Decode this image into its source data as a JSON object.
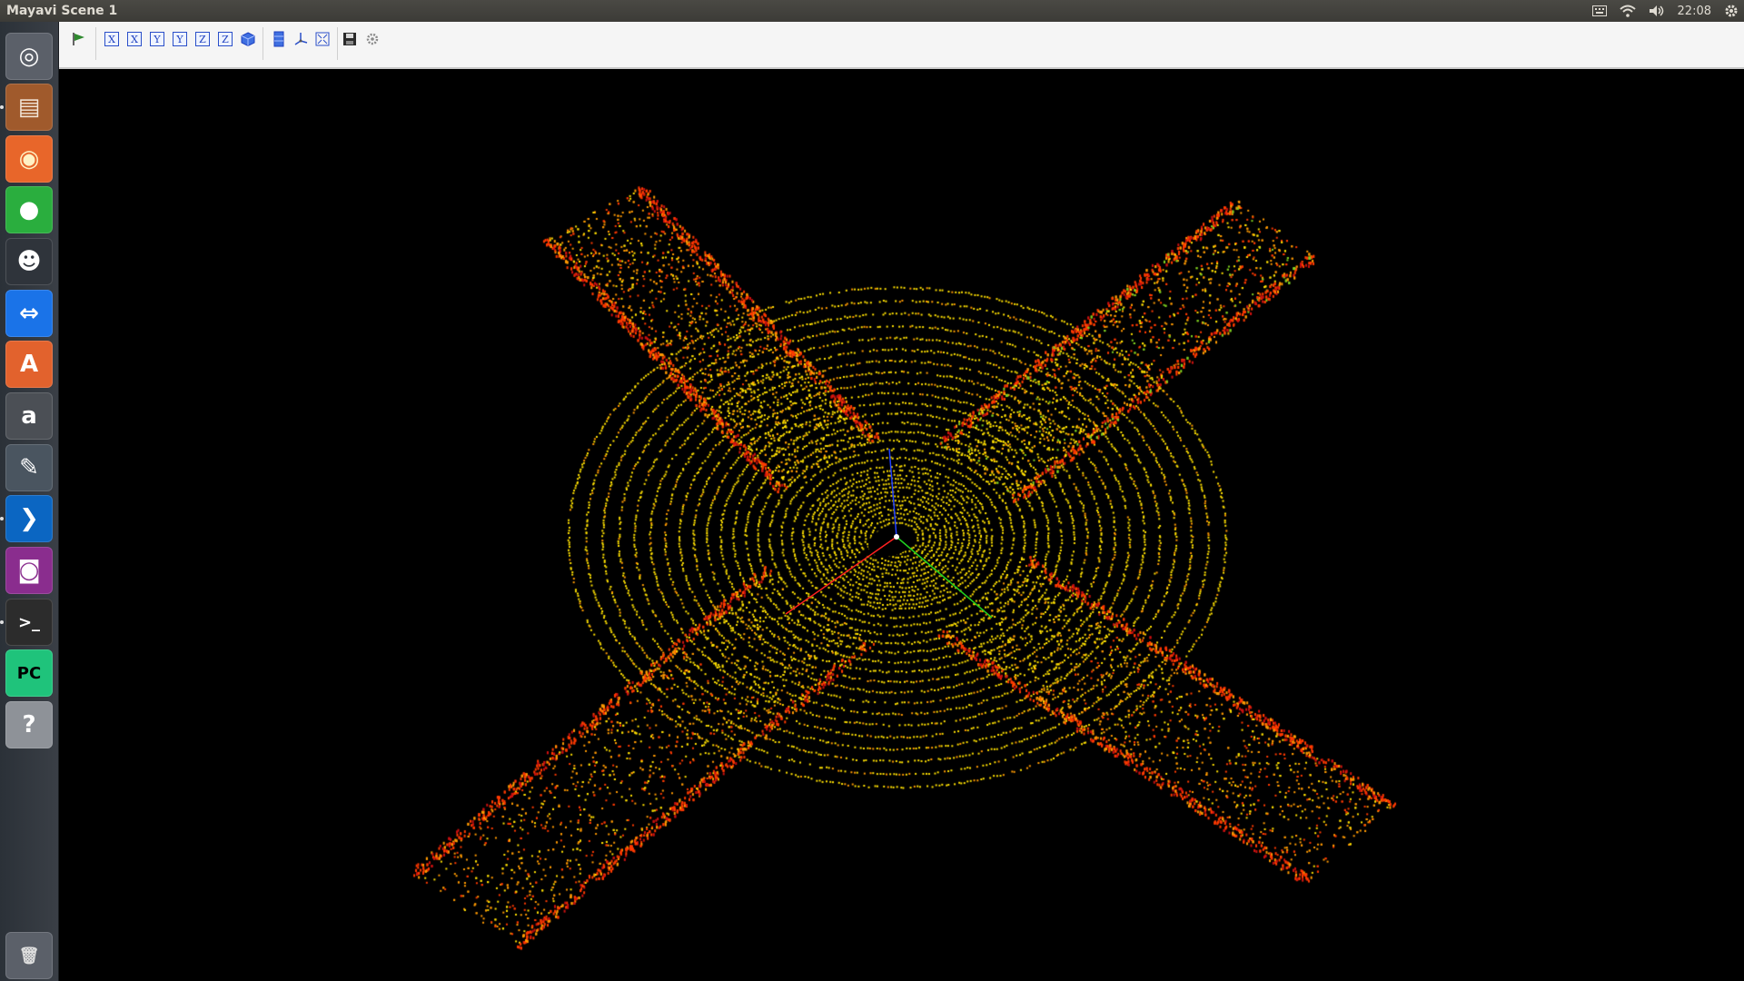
{
  "window": {
    "title": "Mayavi Scene 1"
  },
  "panel": {
    "clock": "22:08",
    "indicators": [
      "keyboard-icon",
      "wifi-icon",
      "volume-icon",
      "settings-gear-icon"
    ]
  },
  "launcher": {
    "items": [
      {
        "name": "dash-home-icon",
        "bg": "#5b6069",
        "glyph": "◎",
        "color": "#ffffff"
      },
      {
        "name": "files-icon",
        "bg": "#a05a2c",
        "glyph": "▤",
        "color": "#f2e6d9"
      },
      {
        "name": "firefox-icon",
        "bg": "#e8662a",
        "glyph": "◉",
        "color": "#fff1c4"
      },
      {
        "name": "wechat-icon",
        "bg": "#2aae3e",
        "glyph": "●",
        "color": "#ffffff"
      },
      {
        "name": "qq-icon",
        "bg": "#2f343b",
        "glyph": "☻",
        "color": "#ffffff"
      },
      {
        "name": "teamviewer-icon",
        "bg": "#1a73e8",
        "glyph": "⇔",
        "color": "#ffffff"
      },
      {
        "name": "software-center-icon",
        "bg": "#e2622d",
        "glyph": "A",
        "color": "#ffffff"
      },
      {
        "name": "amazon-icon",
        "bg": "#4b4f55",
        "glyph": "a",
        "color": "#ffffff"
      },
      {
        "name": "system-settings-icon",
        "bg": "#4a5560",
        "glyph": "✎",
        "color": "#ffffff"
      },
      {
        "name": "vscode-icon",
        "bg": "#0b66c2",
        "glyph": "❯",
        "color": "#ffffff"
      },
      {
        "name": "cheese-camera-icon",
        "bg": "#8a2d8e",
        "glyph": "◙",
        "color": "#ffffff"
      },
      {
        "name": "terminal-icon",
        "bg": "#2c2c2c",
        "glyph": ">_",
        "color": "#ffffff"
      },
      {
        "name": "pycharm-icon",
        "bg": "#1fc37b",
        "glyph": "PC",
        "color": "#000000"
      },
      {
        "name": "help-icon",
        "bg": "#8e9298",
        "glyph": "?",
        "color": "#ffffff"
      },
      {
        "name": "trash-icon",
        "bg": "#5b6069",
        "glyph": "🗑",
        "color": "#dddddd"
      }
    ]
  },
  "toolbar": {
    "buttons": [
      {
        "name": "pipeline-icon",
        "label": ""
      },
      {
        "name": "view-x-minus-button",
        "label": "X"
      },
      {
        "name": "view-x-plus-button",
        "label": "X"
      },
      {
        "name": "view-y-minus-button",
        "label": "Y"
      },
      {
        "name": "view-y-plus-button",
        "label": "Y"
      },
      {
        "name": "view-z-minus-button",
        "label": "Z"
      },
      {
        "name": "view-z-plus-button",
        "label": "Z"
      },
      {
        "name": "isometric-view-button",
        "label": ""
      },
      {
        "name": "parallel-projection-button",
        "label": ""
      },
      {
        "name": "toggle-axes-button",
        "label": ""
      },
      {
        "name": "full-screen-button",
        "label": ""
      },
      {
        "name": "save-scene-button",
        "label": ""
      },
      {
        "name": "configure-scene-button",
        "label": ""
      }
    ]
  },
  "scene": {
    "background": "#000000",
    "axes": {
      "x_color": "#ff2020",
      "y_color": "#20d020",
      "z_color": "#2040ff"
    },
    "colormap": [
      "#ffe000",
      "#ff9a00",
      "#ff3a00",
      "#cc1010",
      "#7fd020"
    ]
  }
}
